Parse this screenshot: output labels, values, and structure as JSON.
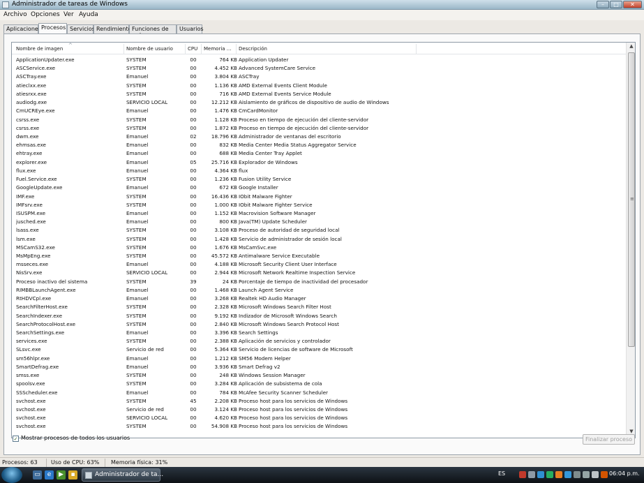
{
  "window": {
    "title": "Administrador de tareas de Windows"
  },
  "menu": [
    "Archivo",
    "Opciones",
    "Ver",
    "Ayuda"
  ],
  "tabs": [
    "Aplicaciones",
    "Procesos",
    "Servicios",
    "Rendimiento",
    "Funciones de red",
    "Usuarios"
  ],
  "active_tab": "Procesos",
  "columns": [
    "Nombre de imagen",
    "Nombre de usuario",
    "CPU",
    "Memoria ...",
    "Descripción"
  ],
  "processes": [
    [
      "ApplicationUpdater.exe",
      "SYSTEM",
      "00",
      "764 KB",
      "Application Updater"
    ],
    [
      "ASCService.exe",
      "SYSTEM",
      "00",
      "4.452 KB",
      "Advanced SystemCare Service"
    ],
    [
      "ASCTray.exe",
      "Emanuel",
      "00",
      "3.804 KB",
      "ASCTray"
    ],
    [
      "atieclxx.exe",
      "SYSTEM",
      "00",
      "1.136 KB",
      "AMD External Events Client Module"
    ],
    [
      "atiesrxx.exe",
      "SYSTEM",
      "00",
      "716 KB",
      "AMD External Events Service Module"
    ],
    [
      "audiodg.exe",
      "SERVICIO LOCAL",
      "00",
      "12.212 KB",
      "Aislamiento de gráficos de dispositivo de audio de Windows"
    ],
    [
      "CmUCREye.exe",
      "Emanuel",
      "00",
      "1.476 KB",
      "CmCardMonitor"
    ],
    [
      "csrss.exe",
      "SYSTEM",
      "00",
      "1.128 KB",
      "Proceso en tiempo de ejecución del cliente-servidor"
    ],
    [
      "csrss.exe",
      "SYSTEM",
      "00",
      "1.872 KB",
      "Proceso en tiempo de ejecución del cliente-servidor"
    ],
    [
      "dwm.exe",
      "Emanuel",
      "02",
      "18.796 KB",
      "Administrador de ventanas del escritorio"
    ],
    [
      "ehmsas.exe",
      "Emanuel",
      "00",
      "832 KB",
      "Media Center Media Status Aggregator Service"
    ],
    [
      "ehtray.exe",
      "Emanuel",
      "00",
      "688 KB",
      "Media Center Tray Applet"
    ],
    [
      "explorer.exe",
      "Emanuel",
      "05",
      "25.716 KB",
      "Explorador de Windows"
    ],
    [
      "flux.exe",
      "Emanuel",
      "00",
      "4.364 KB",
      "flux"
    ],
    [
      "Fuel.Service.exe",
      "SYSTEM",
      "00",
      "1.236 KB",
      "Fusion Utility Service"
    ],
    [
      "GoogleUpdate.exe",
      "Emanuel",
      "00",
      "672 KB",
      "Google Installer"
    ],
    [
      "IMF.exe",
      "SYSTEM",
      "00",
      "16.436 KB",
      "IObit Malware Fighter"
    ],
    [
      "IMFsrv.exe",
      "SYSTEM",
      "00",
      "1.000 KB",
      "IObit Malware Fighter Service"
    ],
    [
      "ISUSPM.exe",
      "Emanuel",
      "00",
      "1.152 KB",
      "Macrovision Software Manager"
    ],
    [
      "jusched.exe",
      "Emanuel",
      "00",
      "800 KB",
      "Java(TM) Update Scheduler"
    ],
    [
      "lsass.exe",
      "SYSTEM",
      "00",
      "3.108 KB",
      "Proceso de autoridad de seguridad local"
    ],
    [
      "lsm.exe",
      "SYSTEM",
      "00",
      "1.428 KB",
      "Servicio de administrador de sesión local"
    ],
    [
      "MSCamS32.exe",
      "SYSTEM",
      "00",
      "1.676 KB",
      "MsCamSvc.exe"
    ],
    [
      "MsMpEng.exe",
      "SYSTEM",
      "00",
      "45.572 KB",
      "Antimalware Service Executable"
    ],
    [
      "msseces.exe",
      "Emanuel",
      "00",
      "4.188 KB",
      "Microsoft Security Client User Interface"
    ],
    [
      "NisSrv.exe",
      "SERVICIO LOCAL",
      "00",
      "2.944 KB",
      "Microsoft Network Realtime Inspection Service"
    ],
    [
      "Proceso inactivo del sistema",
      "SYSTEM",
      "39",
      "24 KB",
      "Porcentaje de tiempo de inactividad del procesador"
    ],
    [
      "RIMBBLaunchAgent.exe",
      "Emanuel",
      "00",
      "1.468 KB",
      "Launch Agent Service"
    ],
    [
      "RtHDVCpl.exe",
      "Emanuel",
      "00",
      "3.268 KB",
      "Realtek HD Audio Manager"
    ],
    [
      "SearchFilterHost.exe",
      "SYSTEM",
      "00",
      "2.328 KB",
      "Microsoft Windows Search Filter Host"
    ],
    [
      "SearchIndexer.exe",
      "SYSTEM",
      "00",
      "9.192 KB",
      "Indizador de Microsoft Windows Search"
    ],
    [
      "SearchProtocolHost.exe",
      "SYSTEM",
      "00",
      "2.840 KB",
      "Microsoft Windows Search Protocol Host"
    ],
    [
      "SearchSettings.exe",
      "Emanuel",
      "00",
      "3.396 KB",
      "Search Settings"
    ],
    [
      "services.exe",
      "SYSTEM",
      "00",
      "2.388 KB",
      "Aplicación de servicios y controlador"
    ],
    [
      "SLsvc.exe",
      "Servicio de red",
      "00",
      "5.364 KB",
      "Servicio de licencias de software de Microsoft"
    ],
    [
      "sm56hlpr.exe",
      "Emanuel",
      "00",
      "1.212 KB",
      "SM56 Modem Helper"
    ],
    [
      "SmartDefrag.exe",
      "Emanuel",
      "00",
      "3.936 KB",
      "Smart Defrag v2"
    ],
    [
      "smss.exe",
      "SYSTEM",
      "00",
      "248 KB",
      "Windows Session Manager"
    ],
    [
      "spoolsv.exe",
      "SYSTEM",
      "00",
      "3.284 KB",
      "Aplicación de subsistema de cola"
    ],
    [
      "SSScheduler.exe",
      "Emanuel",
      "00",
      "784 KB",
      "McAfee Security Scanner Scheduler"
    ],
    [
      "svchost.exe",
      "SYSTEM",
      "45",
      "2.208 KB",
      "Proceso host para los servicios de Windows"
    ],
    [
      "svchost.exe",
      "Servicio de red",
      "00",
      "3.124 KB",
      "Proceso host para los servicios de Windows"
    ],
    [
      "svchost.exe",
      "SERVICIO LOCAL",
      "00",
      "4.620 KB",
      "Proceso host para los servicios de Windows"
    ],
    [
      "svchost.exe",
      "SYSTEM",
      "00",
      "54.908 KB",
      "Proceso host para los servicios de Windows"
    ]
  ],
  "show_all_users": {
    "label": "Mostrar procesos de todos los usuarios",
    "checked": true
  },
  "end_process_label": "Finalizar proceso",
  "status": {
    "processes": "Procesos: 63",
    "cpu": "Uso de CPU: 63%",
    "memory": "Memoria física: 31%"
  },
  "taskbar": {
    "task_label": "Administrador de ta...",
    "language": "ES",
    "clock": "06:04 p.m."
  },
  "colors": {
    "taskbar": "#1a2129",
    "close_button": "#c2412a",
    "checkmark": "#2b5d1e"
  }
}
